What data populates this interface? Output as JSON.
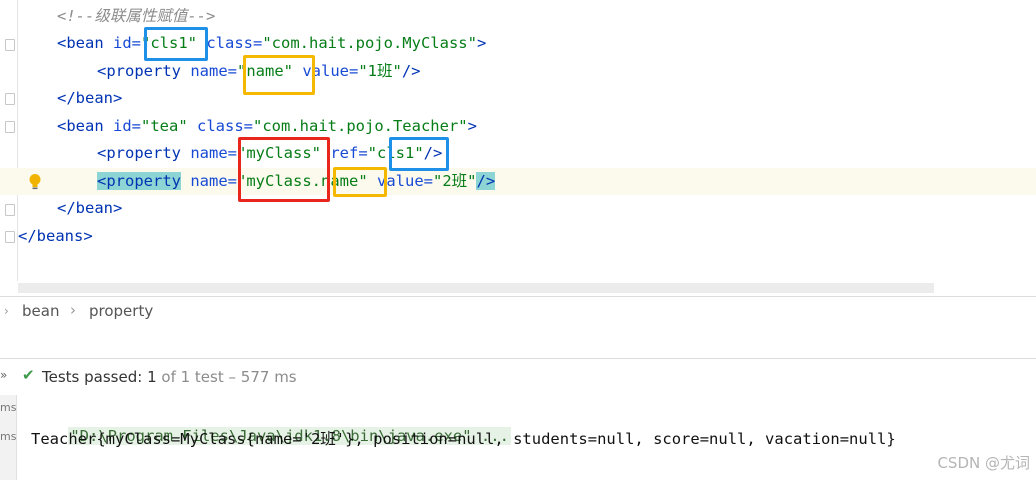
{
  "editor": {
    "lines": [
      {
        "comment": "<!--级联属性赋值-->"
      },
      {
        "open": "<bean",
        "a1": " id=",
        "v1": "\"cls1\"",
        "a2": " class=",
        "v2": "\"com.hait.pojo.MyClass\"",
        "close": ">"
      },
      {
        "open": "<property",
        "a1": " name=",
        "v1": "\"name\"",
        "a2": " value=",
        "v2": "\"1班\"",
        "close": "/>"
      },
      {
        "close": "</bean>"
      },
      {
        "open": "<bean",
        "a1": " id=",
        "v1": "\"tea\"",
        "a2": " class=",
        "v2": "\"com.hait.pojo.Teacher\"",
        "close": ">"
      },
      {
        "open": "<property",
        "a1": " name=",
        "v1": "\"myClass\"",
        "a2": " ref=",
        "v2": "\"cls1\"",
        "close": "/>"
      },
      {
        "open": "<property",
        "a1": " name=",
        "v1": "\"myClass.name\"",
        "a2": " value=",
        "v2": "\"2班\"",
        "close": "/>"
      },
      {
        "close": "</bean>"
      },
      {
        "close": "</beans>"
      }
    ]
  },
  "breadcrumb": {
    "items": [
      "bean",
      "property"
    ],
    "separator": "›"
  },
  "run": {
    "status_label": "Tests passed:",
    "passed": "1",
    "of_total": "of 1 test",
    "dash": "–",
    "duration": "577 ms",
    "gutter_labels": [
      "ms",
      "ms"
    ],
    "console": [
      "\"D:\\Program Files\\Java\\jdk1.8\\bin\\java.exe\" ...",
      "Teacher{myClass=MyClass{name='2班'}, position=null, students=null, score=null, vacation=null}"
    ]
  },
  "watermark": "CSDN @尤词",
  "colors": {
    "blue_box": "#1e90e8",
    "orange_box": "#f5b800",
    "red_box": "#e8261c",
    "pass_green": "#3e9a4a"
  }
}
